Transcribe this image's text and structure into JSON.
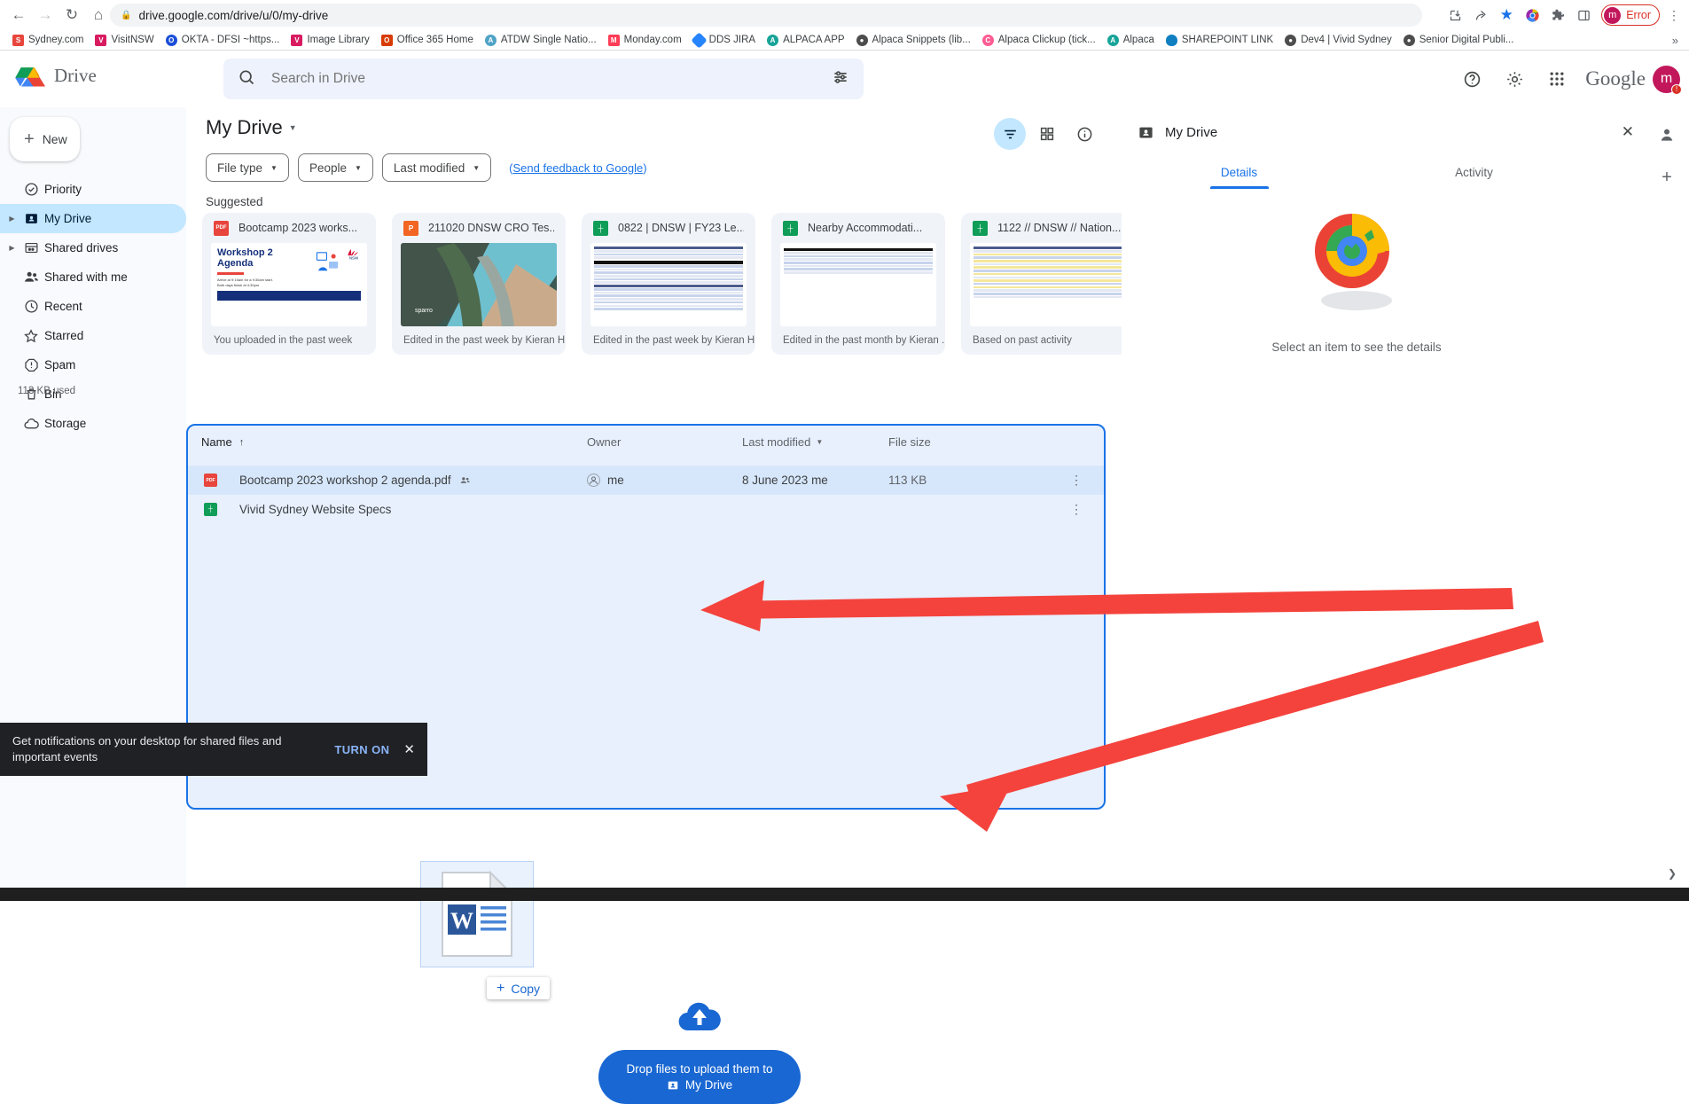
{
  "browser": {
    "url": "drive.google.com/drive/u/0/my-drive",
    "back_icon": "back-arrow-icon",
    "forward_icon": "forward-arrow-icon",
    "reload_icon": "reload-icon",
    "home_icon": "home-icon",
    "lock_icon": "lock-icon",
    "profile_label": "Error",
    "profile_initial": "m",
    "right_icons": [
      "install-icon",
      "share-icon",
      "bookmark-star-icon",
      "extension-color-icon",
      "extensions-puzzle-icon",
      "side-panel-icon"
    ],
    "menu_icon": "three-dot-menu-icon",
    "bookmarks": [
      {
        "label": "Sydney.com",
        "color": "#e8453c"
      },
      {
        "label": "VisitNSW",
        "color": "#d81b60"
      },
      {
        "label": "OKTA - DFSI ~https...",
        "color": "#1b4ed8"
      },
      {
        "label": "Image Library",
        "color": "#d81b60"
      },
      {
        "label": "Office 365 Home",
        "color": "#d83b01"
      },
      {
        "label": "ATDW Single Natio...",
        "color": "#4fa3c7"
      },
      {
        "label": "Monday.com",
        "color": "#ff3d57"
      },
      {
        "label": "DDS JIRA",
        "color": "#2684ff"
      },
      {
        "label": "ALPACA APP",
        "color": "#17a398"
      },
      {
        "label": "Alpaca Snippets (lib...",
        "color": "#4d4d4d"
      },
      {
        "label": "Alpaca Clickup (tick...",
        "color": "#ff5c93"
      },
      {
        "label": "Alpaca",
        "color": "#17a398"
      },
      {
        "label": "SHAREPOINT LINK",
        "color": "#0f7fc1"
      },
      {
        "label": "Dev4 | Vivid Sydney",
        "color": "#4d4d4d"
      },
      {
        "label": "Senior Digital Publi...",
        "color": "#4d4d4d"
      }
    ],
    "overflow_label": "»"
  },
  "drive_header": {
    "wordmark": "Drive",
    "logo_icon": "google-drive-logo-icon",
    "search_placeholder": "Search in Drive",
    "search_value": "",
    "search_icon": "search-icon",
    "tune_icon": "search-options-icon",
    "help_icon": "help-icon",
    "settings_icon": "gear-icon",
    "apps_icon": "apps-grid-icon",
    "google_wordmark": "Google",
    "avatar_initial": "m",
    "avatar_badge": "!"
  },
  "sidebar": {
    "new_label": "New",
    "new_icon": "plus-icon",
    "storage_used": "113 KB used",
    "items": [
      {
        "label": "Priority",
        "icon": "priority-check-icon",
        "expandable": false,
        "active": false
      },
      {
        "label": "My Drive",
        "icon": "my-drive-icon",
        "expandable": true,
        "active": true
      },
      {
        "label": "Shared drives",
        "icon": "shared-drives-icon",
        "expandable": true,
        "active": false
      },
      {
        "label": "Shared with me",
        "icon": "people-icon",
        "expandable": false,
        "active": false
      },
      {
        "label": "Recent",
        "icon": "clock-icon",
        "expandable": false,
        "active": false
      },
      {
        "label": "Starred",
        "icon": "star-icon",
        "expandable": false,
        "active": false
      },
      {
        "label": "Spam",
        "icon": "spam-icon",
        "expandable": false,
        "active": false
      },
      {
        "label": "Bin",
        "icon": "trash-icon",
        "expandable": false,
        "active": false
      },
      {
        "label": "Storage",
        "icon": "cloud-icon",
        "expandable": false,
        "active": false
      }
    ]
  },
  "main": {
    "title": "My Drive",
    "title_caret_icon": "chevron-down-icon",
    "filters": [
      {
        "label": "File type"
      },
      {
        "label": "People"
      },
      {
        "label": "Last modified"
      }
    ],
    "feedback_prefix": "(",
    "feedback_label": "Send feedback to Google",
    "feedback_suffix": ")",
    "view_controls": [
      {
        "icon": "filter-list-icon",
        "selected": true
      },
      {
        "icon": "grid-view-icon",
        "selected": false
      },
      {
        "icon": "info-icon",
        "selected": false
      }
    ],
    "suggested_label": "Suggested",
    "cards": [
      {
        "name": "Bootcamp 2023 works...",
        "type": "pdf",
        "icon_color": "#e8453c",
        "icon_text": "PDF",
        "footer": "You uploaded in the past week",
        "thumb": "workshop-agenda-thumbnail"
      },
      {
        "name": "211020 DNSW CRO Tes...",
        "type": "slides",
        "icon_color": "#f26522",
        "icon_text": "P",
        "footer": "Edited in the past week by Kieran H...",
        "thumb": "coastline-photo-thumbnail"
      },
      {
        "name": "0822 | DNSW | FY23 Le...",
        "type": "sheets",
        "icon_color": "#0f9d58",
        "icon_text": "┼",
        "footer": "Edited in the past week by Kieran H...",
        "thumb": "spreadsheet-thumbnail"
      },
      {
        "name": "Nearby Accommodati...",
        "type": "sheets",
        "icon_color": "#0f9d58",
        "icon_text": "┼",
        "footer": "Edited in the past month by Kieran ...",
        "thumb": "spreadsheet-thumbnail"
      },
      {
        "name": "1122 // DNSW // Nation...",
        "type": "sheets",
        "icon_color": "#0f9d58",
        "icon_text": "┼",
        "footer": "Based on past activity",
        "thumb": "spreadsheet-thumbnail"
      }
    ],
    "table": {
      "columns": [
        "Name",
        "Owner",
        "Last modified",
        "File size"
      ],
      "sort_icon": "sort-ascending-icon",
      "modified_caret_icon": "chevron-down-icon",
      "rows": [
        {
          "name": "Bootcamp 2023 workshop 2 agenda.pdf",
          "icon_color": "#e8453c",
          "icon_text": "PDF",
          "shared_icon": "shared-people-icon",
          "owner": "me",
          "modified": "8 June 2023  me",
          "size": "113 KB",
          "more_icon": "more-vertical-icon",
          "selected": true
        },
        {
          "name": "Vivid Sydney Website Specs",
          "icon_color": "#0f9d58",
          "icon_text": "┼",
          "shared_icon": "",
          "owner": "",
          "modified": "",
          "size": "",
          "more_icon": "more-vertical-icon",
          "selected": false
        }
      ]
    },
    "drag": {
      "ghost_icon": "word-document-icon",
      "copy_label": "Copy",
      "copy_plus_icon": "plus-icon"
    },
    "upload": {
      "cloud_icon": "upload-cloud-icon",
      "line1": "Drop files to upload them to",
      "line2": "My Drive",
      "destination_icon": "my-drive-icon"
    }
  },
  "details_panel": {
    "icon": "my-drive-icon",
    "title": "My Drive",
    "close_icon": "close-icon",
    "tabs": [
      {
        "label": "Details",
        "active": true
      },
      {
        "label": "Activity",
        "active": false
      }
    ],
    "empty_art_icon": "empty-details-illustration-icon",
    "empty_text": "Select an item to see the details"
  },
  "right_rail": {
    "buttons": [
      {
        "icon": "contacts-icon"
      },
      {
        "icon": "plus-icon"
      }
    ]
  },
  "toast": {
    "text": "Get notifications on your desktop for shared files and important events",
    "action_label": "TURN ON",
    "close_icon": "close-icon"
  },
  "annotations": {
    "arrow_color": "#f4433c",
    "arrows": [
      {
        "name": "arrow-pointing-to-drag-ghost"
      },
      {
        "name": "arrow-pointing-to-drop-target"
      }
    ]
  },
  "scroll_hint_icon": "chevron-right-icon"
}
